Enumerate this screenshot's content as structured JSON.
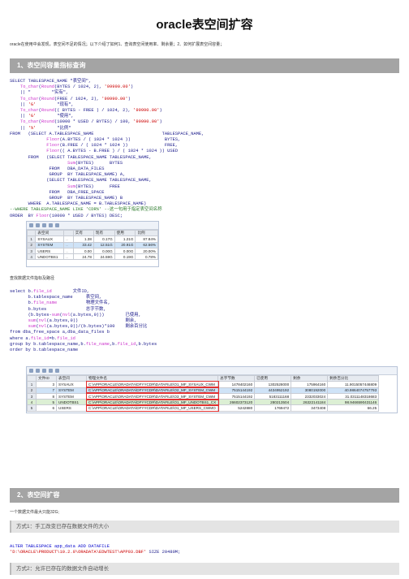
{
  "page": {
    "title": "oracle表空间扩容",
    "intro": "oracle在使用中会发现，表空间不足的情况；以下介绍了如何1、查询表空间使用率、剩余量；2、如何扩展表空间容量；"
  },
  "section1": {
    "heading": "1、表空间容量指标查询",
    "sql_lines": [
      "SELECT TABLESPACE_NAME \"表空间\",",
      "    To_char(Round(BYTES / 1024, 2), '99990.00')",
      "    || \"        \"实有\",",
      "    To_char(Round(FREE / 1024, 2), '99990.00')",
      "    || 'G'        \"现有\",",
      "    To_char(Round(( BYTES - FREE ) / 1024, 2), '99990.00')",
      "    || 'G'        \"使用\",",
      "    To_char(Round(10000 * USED / BYTES) / 100, '99990.00')",
      "    || '%'        \"比例\"",
      "FROM   (SELECT A.TABLESPACE_NAME                          TABLESPACE_NAME,",
      "              Floor(A.BYTES / ( 1024 * 1024 ))             BYTES,",
      "              Floor(B.FREE / ( 1024 * 1024 ))              FREE,",
      "              Floor(( A.BYTES - B.FREE ) / ( 1024 * 1024 )) USED",
      "       FROM   (SELECT TABLESPACE_NAME TABLESPACE_NAME,",
      "                      Sum(BYTES)      BYTES",
      "               FROM   DBA_DATA_FILES",
      "               GROUP  BY TABLESPACE_NAME) A,",
      "              (SELECT TABLESPACE_NAME TABLESPACE_NAME,",
      "                      Sum(BYTES)      FREE",
      "               FROM   DBA_FREE_SPACE",
      "               GROUP  BY TABLESPACE_NAME) B",
      "       WHERE  A.TABLESPACE_NAME = B.TABLESPACE_NAME)",
      "--WHERE TABLESPACE_NAME LIKE 'CDR%' --这一句用于指定表空间名称",
      "ORDER  BY Floor(10000 * USED / BYTES) DESC;"
    ],
    "result1": {
      "columns": [
        "",
        "表空间",
        "",
        "实有",
        "现有",
        "使用",
        "比例"
      ],
      "rows": [
        [
          "1",
          "SYSAUX",
          "...",
          "1.38",
          "0.17G",
          "1.21G",
          "87.84%"
        ],
        [
          "2",
          "SYSTEM",
          "...",
          "33.42",
          "12.51G",
          "20.91G",
          "62.56%"
        ],
        [
          "3",
          "USERS",
          "...",
          "0.00",
          "0.00G",
          "0.00G",
          "20.00%"
        ],
        [
          "4",
          "UNDOTBS1",
          "...",
          "24.78",
          "24.59G",
          "0.19G",
          "0.78%"
        ]
      ]
    },
    "subtitle2": "查找数据文件指标及路径",
    "sql2_lines": [
      "select b.file_id        文件ID,",
      "       b.tablespace_name     表空间,",
      "       b.file_name           物理文件名,",
      "       b.bytes               总字节数,",
      "       (b.bytes-sum(nvl(a.bytes,0)))        已使用,",
      "       sum(nvl(a.bytes,0))                  剩余,",
      "       sum(nvl(a.bytes,0))/(b.bytes)*100    剩余百分比",
      "from dba_free_space a,dba_data_files b",
      "where a.file_id=b.file_id",
      "group by b.tablespace_name,b.file_name,b.file_id,b.bytes",
      "order by b.tablespace_name"
    ],
    "result2": {
      "columns": [
        "",
        "文件ID",
        "表空间",
        "物理文件名",
        "总字节数",
        "已使用",
        "剩余",
        "剩余百分比"
      ],
      "rows": [
        [
          "1",
          "3",
          "SYSAUX",
          "C:\\APP\\ORACLE\\ORADATA\\DFYYCDR\\DATAFILE\\O1_MF_SYSAUX_CWM",
          "1478402160",
          "1302528000",
          "175964160",
          "11.9015057446809"
        ],
        [
          "2",
          "7",
          "SYSTEM",
          "C:\\APP\\ORACLE\\ORADATA\\DFYYCDR\\DATAFILE\\O2_MF_SYSTEM_CWM",
          "7515144192",
          "4434952192",
          "3080192000",
          "40.9864074757793"
        ],
        [
          "3",
          "8",
          "SYSTEM",
          "C:\\APP\\ORACLE\\ORADATA\\DFYYCDR\\DATAFILE\\O3_MF_SYSTEM_CWM",
          "7515144192",
          "5183111168",
          "2332033024",
          "31.0311148318683"
        ],
        [
          "4",
          "5",
          "UNDOTBS1",
          "C:\\APP\\ORACLE\\ORADATA\\DFYYCDR\\DATAFILE\\O1_MF_UNDOTBS1_CX",
          "26602373120",
          "280213504",
          "26322141184",
          "98.9466590431146"
        ],
        [
          "5",
          "6",
          "USERS",
          "C:\\APP\\ORACLE\\ORADATA\\DFYYCDR\\DATAFILE\\O1_MF_USERS_CWMO",
          "5242880",
          "1769472",
          "3473408",
          "66.25"
        ]
      ]
    }
  },
  "section2": {
    "heading": "2、表空间扩容",
    "intro": "一个数据文件最大只能32G;",
    "method1": "方式1：手工改变已存在数据文件的大小",
    "method1_sql1": "ALTER TABLESPACE app_data ADD DATAFILE",
    "method1_sql2_str": "'D:\\ORACLE\\PRODUCT\\10.2.0\\ORADATA\\EDWTEST\\APP03.DBF'",
    "method1_sql2_rest": " SIZE 20480M;",
    "method2": "方式2：允许已存在的数据文件自动增长"
  }
}
